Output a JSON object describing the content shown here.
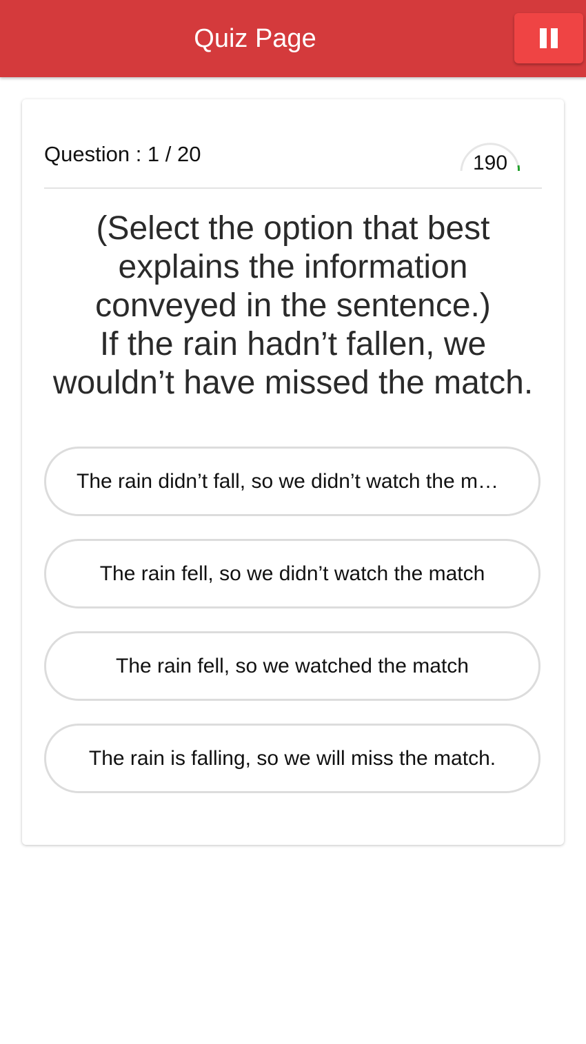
{
  "header": {
    "title": "Quiz Page",
    "pause_icon": "pause-icon",
    "background_color": "#d43a3c",
    "pause_button_color": "#ef4444"
  },
  "quiz": {
    "question_counter": "Question : 1 / 20",
    "timer": {
      "value": "190",
      "progress_color": "#22a02b"
    },
    "question_lines": [
      "(Select the option that best explains the information conveyed in the sentence.)",
      "If the rain hadn’t fallen, we wouldn’t have missed the match."
    ],
    "options": [
      "The rain didn’t fall, so we didn’t watch the match",
      "The rain fell, so we didn’t watch the match",
      "The rain fell, so we watched the match",
      "The rain is falling, so we will miss the match."
    ]
  }
}
